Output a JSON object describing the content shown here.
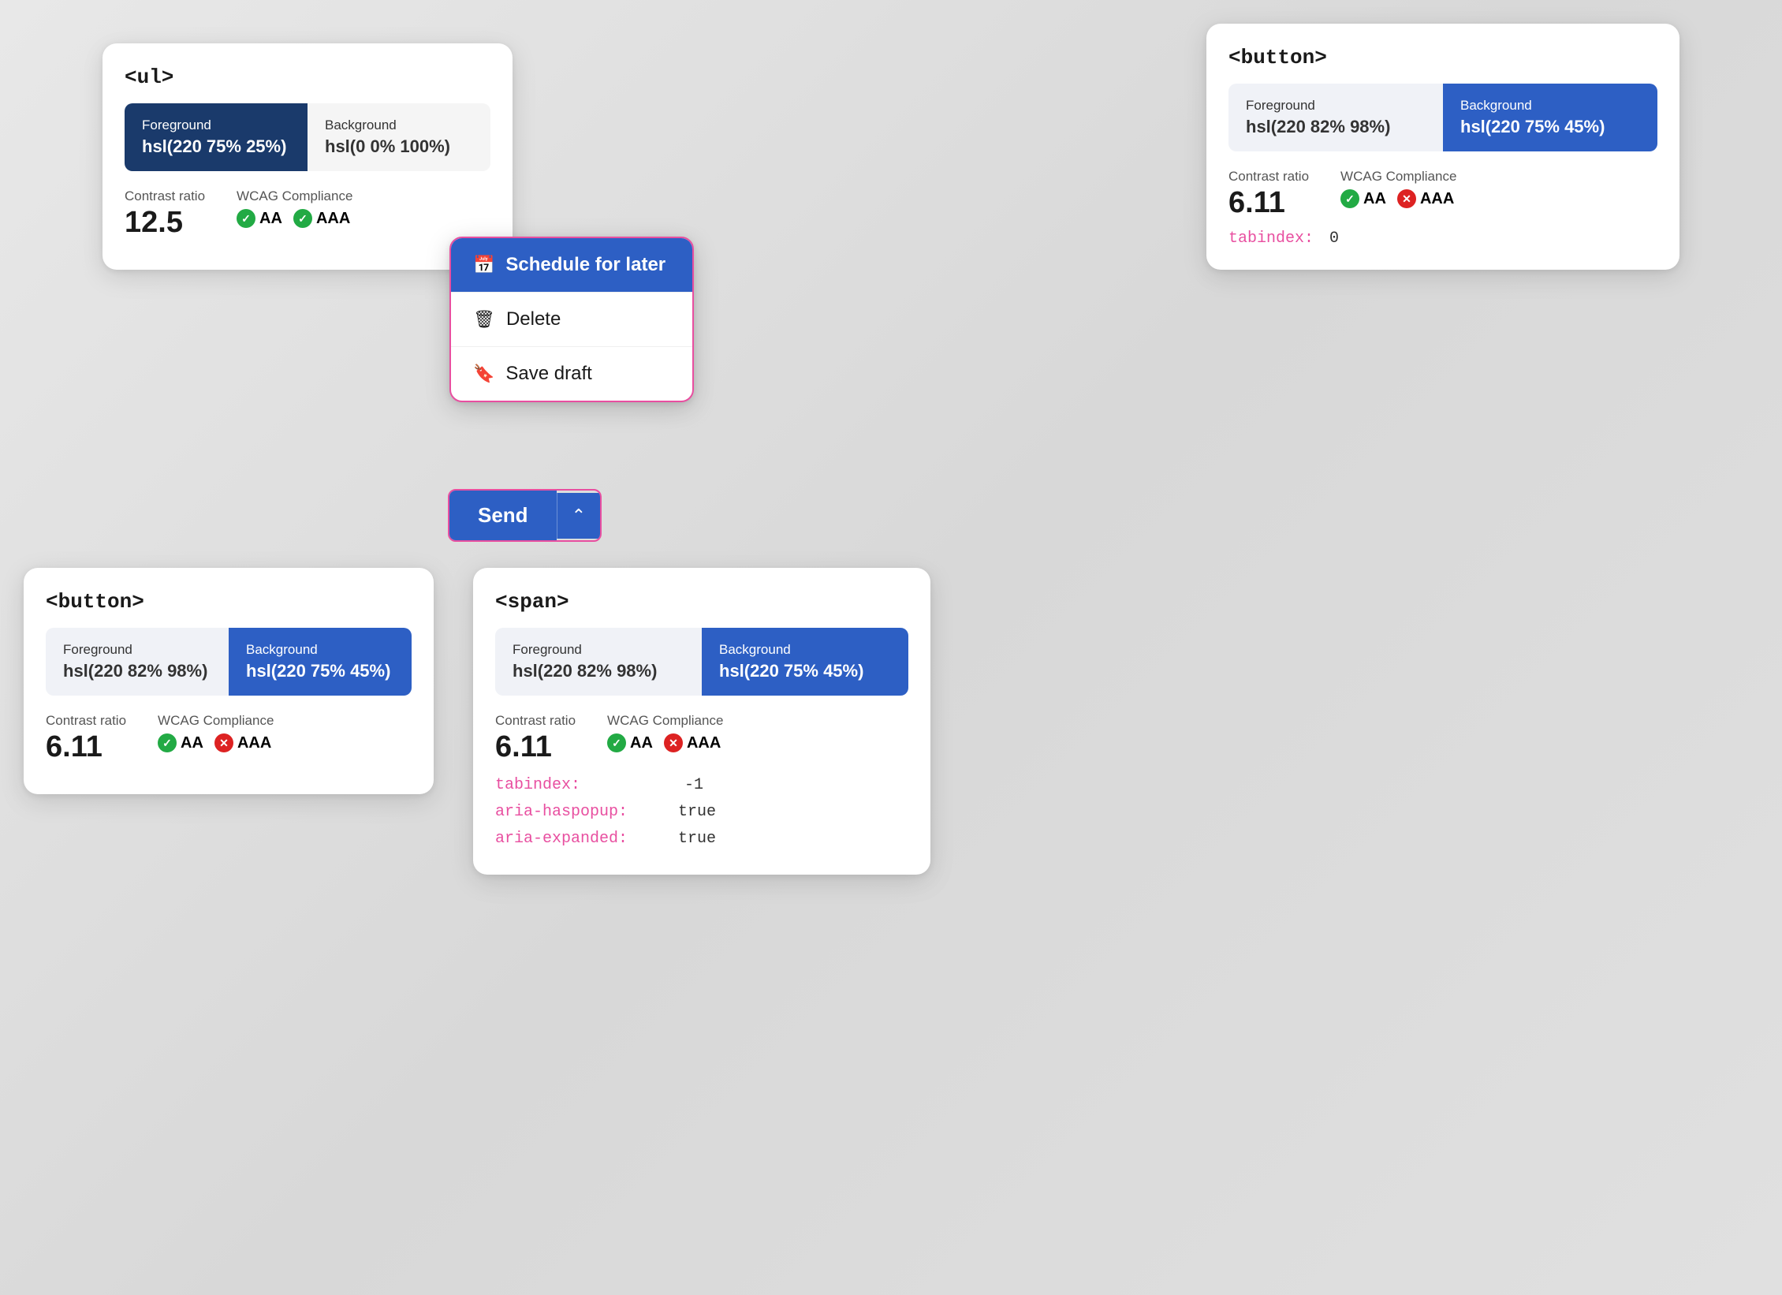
{
  "cards": {
    "ul_card": {
      "tag": "<ul>",
      "foreground_label": "Foreground",
      "foreground_value": "hsl(220 75% 25%)",
      "background_label": "Background",
      "background_value": "hsl(0 0% 100%)",
      "contrast_label": "Contrast ratio",
      "contrast_value": "12.5",
      "wcag_label": "WCAG Compliance",
      "aa_label": "AA",
      "aaa_label": "AAA",
      "aa_pass": true,
      "aaa_pass": true
    },
    "button_card_top": {
      "tag": "<button>",
      "foreground_label": "Foreground",
      "foreground_value": "hsl(220 82% 98%)",
      "background_label": "Background",
      "background_value": "hsl(220 75% 45%)",
      "contrast_label": "Contrast ratio",
      "contrast_value": "6.11",
      "wcag_label": "WCAG Compliance",
      "aa_label": "AA",
      "aaa_label": "AAA",
      "aa_pass": true,
      "aaa_pass": false,
      "tabindex_label": "tabindex:",
      "tabindex_value": "0"
    },
    "button_card_bottom": {
      "tag": "<button>",
      "foreground_label": "Foreground",
      "foreground_value": "hsl(220 82% 98%)",
      "background_label": "Background",
      "background_value": "hsl(220 75% 45%)",
      "contrast_label": "Contrast ratio",
      "contrast_value": "6.11",
      "wcag_label": "WCAG Compliance",
      "aa_label": "AA",
      "aaa_label": "AAA",
      "aa_pass": true,
      "aaa_pass": false
    },
    "span_card": {
      "tag": "<span>",
      "foreground_label": "Foreground",
      "foreground_value": "hsl(220 82% 98%)",
      "background_label": "Background",
      "background_value": "hsl(220 75% 45%)",
      "contrast_label": "Contrast ratio",
      "contrast_value": "6.11",
      "wcag_label": "WCAG Compliance",
      "aa_label": "AA",
      "aaa_label": "AAA",
      "aa_pass": true,
      "aaa_pass": false,
      "tabindex_label": "tabindex:",
      "tabindex_value": "-1",
      "aria_haspopup_label": "aria-haspopup:",
      "aria_haspopup_value": "true",
      "aria_expanded_label": "aria-expanded:",
      "aria_expanded_value": "true"
    }
  },
  "dropdown": {
    "items": [
      {
        "label": "Schedule for later",
        "icon": "📅",
        "active": true
      },
      {
        "label": "Delete",
        "icon": "🗑",
        "active": false
      },
      {
        "label": "Save draft",
        "icon": "🔖",
        "active": false
      }
    ]
  },
  "send_button": {
    "label": "Send",
    "chevron": "⌃"
  },
  "colors": {
    "blue_dark": "#1a3a6b",
    "blue_mid": "#2d5fc4",
    "accent_pink": "#e84fa0",
    "check_green": "#22aa44",
    "x_red": "#dd2222"
  }
}
